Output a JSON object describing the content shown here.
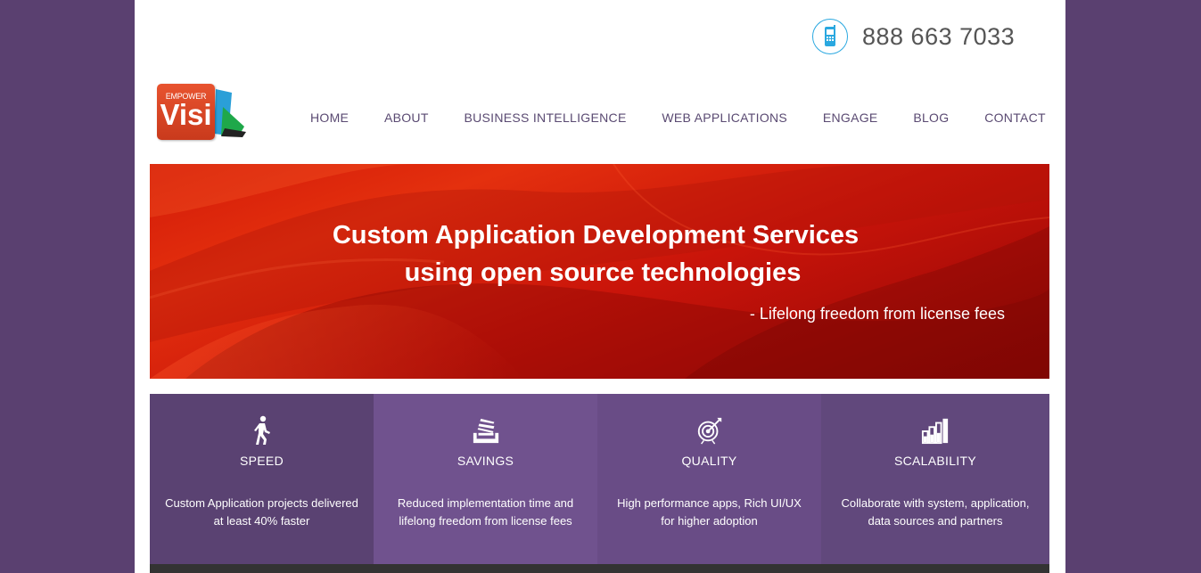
{
  "header": {
    "phone": "888 663 7033",
    "phone_icon": "mobile-phone-icon"
  },
  "logo": {
    "top_text": "EMPOWER",
    "main_text": "Visi"
  },
  "nav": {
    "items": [
      {
        "label": "HOME"
      },
      {
        "label": "ABOUT"
      },
      {
        "label": "BUSINESS INTELLIGENCE"
      },
      {
        "label": "WEB APPLICATIONS"
      },
      {
        "label": "ENGAGE"
      },
      {
        "label": "BLOG"
      },
      {
        "label": "CONTACT"
      }
    ]
  },
  "hero": {
    "line1": "Custom Application Development Services",
    "line2": "using open source technologies",
    "tagline": "- Lifelong freedom from license fees"
  },
  "features": [
    {
      "title": "SPEED",
      "icon": "walking-person-icon",
      "color": "#5a4272",
      "desc_line1": "Custom Application projects delivered",
      "desc_line2": "at least 40% faster"
    },
    {
      "title": "SAVINGS",
      "icon": "stacked-coins-icon",
      "color": "#70528e",
      "desc_line1": "Reduced implementation time and",
      "desc_line2": "lifelong freedom from license fees"
    },
    {
      "title": "QUALITY",
      "icon": "target-icon",
      "color": "#694c86",
      "desc_line1": "High performance apps, Rich UI/UX",
      "desc_line2": "for higher adoption"
    },
    {
      "title": "SCALABILITY",
      "icon": "bar-chart-icon",
      "color": "#61487c",
      "desc_line1": "Collaborate with system, application,",
      "desc_line2": "data sources and partners"
    }
  ],
  "colors": {
    "background": "#5a4070",
    "nav_text": "#5a4a72",
    "phone_ring": "#2aa8e0",
    "hero_red": "#d21a08"
  }
}
